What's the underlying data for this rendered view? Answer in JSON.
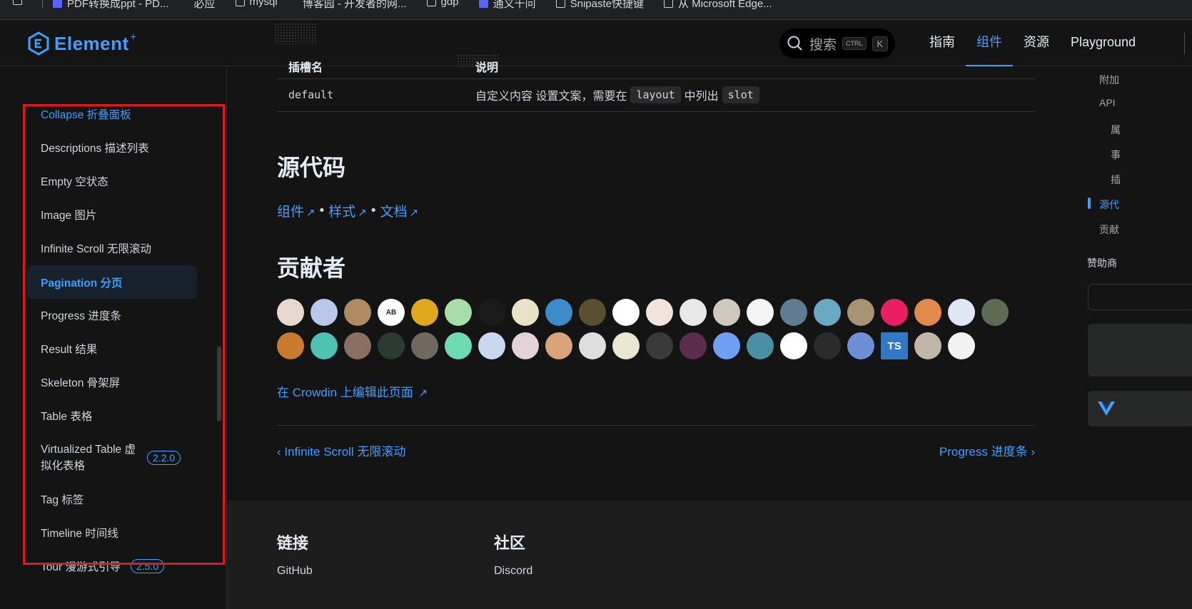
{
  "bookmarks": [
    {
      "label": "PDF转换成ppt - PD...",
      "icon": "document-icon"
    },
    {
      "label": "必应",
      "icon": "bing-icon"
    },
    {
      "label": "mysql",
      "icon": "folder-icon"
    },
    {
      "label": "博客园 - 开发者的网...",
      "icon": "cnblogs-icon"
    },
    {
      "label": "gdp",
      "icon": "folder-icon"
    },
    {
      "label": "通义千问",
      "icon": "tongyi-icon"
    },
    {
      "label": "Snipaste快捷键",
      "icon": "folder-icon"
    },
    {
      "label": "从 Microsoft Edge...",
      "icon": "folder-icon"
    }
  ],
  "header": {
    "logo_text": "Element",
    "logo_sup": "+",
    "search_label": "搜索",
    "kbd_ctrl": "CTRL",
    "kbd_k": "K",
    "nav": [
      {
        "label": "指南",
        "active": false
      },
      {
        "label": "组件",
        "active": true
      },
      {
        "label": "资源",
        "active": false
      },
      {
        "label": "Playground",
        "active": false
      }
    ]
  },
  "sidebar": {
    "items": [
      {
        "label": "Collapse 折叠面板",
        "state": "link"
      },
      {
        "label": "Descriptions 描述列表",
        "state": ""
      },
      {
        "label": "Empty 空状态",
        "state": ""
      },
      {
        "label": "Image 图片",
        "state": ""
      },
      {
        "label": "Infinite Scroll 无限滚动",
        "state": ""
      },
      {
        "label": "Pagination 分页",
        "state": "active"
      },
      {
        "label": "Progress 进度条",
        "state": ""
      },
      {
        "label": "Result 结果",
        "state": ""
      },
      {
        "label": "Skeleton 骨架屏",
        "state": ""
      },
      {
        "label": "Table 表格",
        "state": ""
      },
      {
        "label": "Virtualized Table 虚拟化表格",
        "state": "",
        "badge": "2.2.0"
      },
      {
        "label": "Tag 标签",
        "state": ""
      },
      {
        "label": "Timeline 时间线",
        "state": ""
      },
      {
        "label": "Tour 漫游式引导",
        "state": "",
        "badge": "2.5.0"
      }
    ]
  },
  "slots_table": {
    "header_name": "插槽名",
    "header_desc": "说明",
    "row_name": "default",
    "row_desc_pre": "自定义内容 设置文案，需要在",
    "row_code1": "layout",
    "row_desc_mid": "中列出",
    "row_code2": "slot"
  },
  "source": {
    "heading": "源代码",
    "links": [
      "组件",
      "样式",
      "文档"
    ],
    "separator": "•"
  },
  "contributors": {
    "heading": "贡献者",
    "row1": [
      "#e8d9cf",
      "#b9c8e8",
      "#b08a63",
      "#ffffff",
      "#e0a91c",
      "#a8dca8",
      "#1a1a1a",
      "#e9e2c8",
      "#3d8ac9",
      "#5a5030",
      "#ffffff",
      "#f2e4dd",
      "#e8e8e8",
      "#cfc8c0",
      "#f5f5f5",
      "#5f7c94",
      "#6aa9c4",
      "#a89475",
      "#e91e63",
      "#e08a4b",
      "#dfe6f7",
      "#5d6b55"
    ],
    "row2": [
      "#c97a2e",
      "#4fc3b3",
      "#8a7060",
      "#2a3b34",
      "#6f6a60",
      "#6fdbb5",
      "#c9d8ef",
      "#e3d3d8",
      "#d9a47a",
      "#dedede",
      "#e9e7d4",
      "#3a3a3a",
      "#5b2c4b",
      "#6f9ff0",
      "#4a90a4",
      "#ffffff",
      "#2b2b2b",
      "#6d8fd6",
      "#1d1d1d",
      "#c2b6a8",
      "#f2f2f2"
    ],
    "ab_label": "AB",
    "ts_label": "TS"
  },
  "crowdin_link": "在 Crowdin 上编辑此页面",
  "pager": {
    "prev": "Infinite Scroll 无限滚动",
    "next": "Progress 进度条"
  },
  "footer": {
    "col1_title": "链接",
    "col1_item": "GitHub",
    "col2_title": "社区",
    "col2_item": "Discord"
  },
  "aside": {
    "toc": [
      {
        "label": "附加",
        "indent": false,
        "active": false
      },
      {
        "label": "API",
        "indent": false,
        "active": false
      },
      {
        "label": "属",
        "indent": true,
        "active": false
      },
      {
        "label": "事",
        "indent": true,
        "active": false
      },
      {
        "label": "插",
        "indent": true,
        "active": false
      },
      {
        "label": "源代",
        "indent": false,
        "active": true
      },
      {
        "label": "贡献",
        "indent": false,
        "active": false
      }
    ],
    "sponsors_label": "赞助商"
  },
  "colors": {
    "accent": "#409eff",
    "background": "#141414",
    "highlight_box": "#e01a1a"
  }
}
